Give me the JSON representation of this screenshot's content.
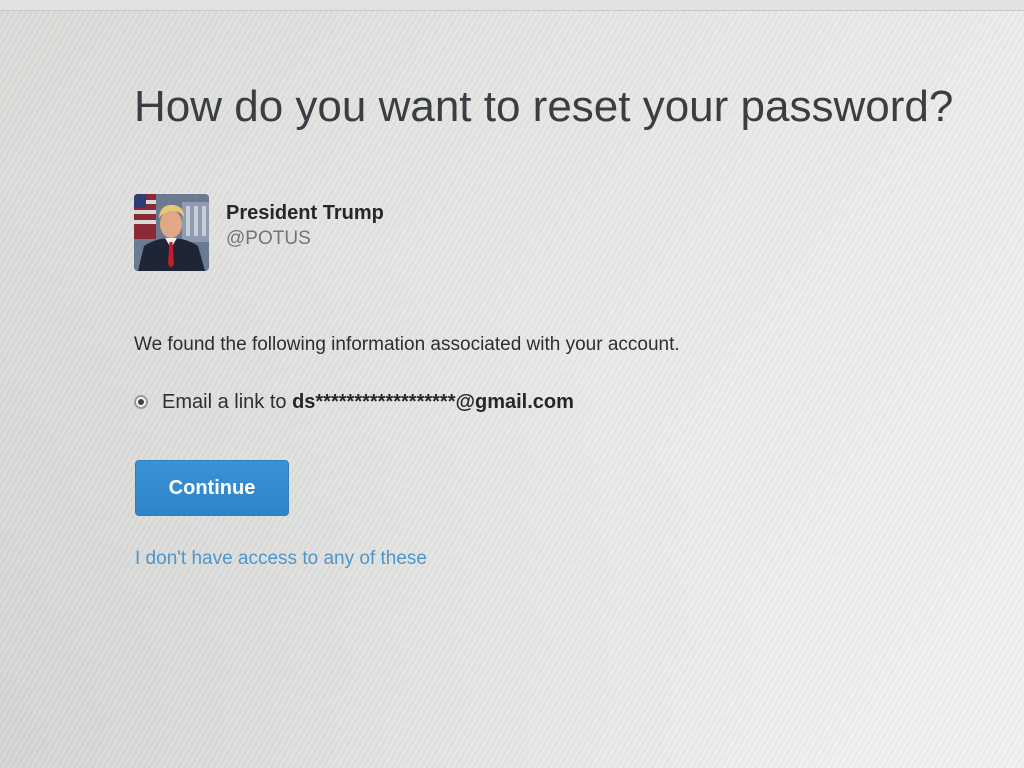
{
  "page": {
    "title": "How do you want to reset your password?"
  },
  "account": {
    "name": "President Trump",
    "handle": "@POTUS",
    "avatar_icon": "profile-photo"
  },
  "info_text": "We found the following information associated with your account.",
  "reset_option": {
    "label_prefix": "Email a link to",
    "email": "ds******************@gmail.com",
    "selected": true
  },
  "actions": {
    "continue_label": "Continue",
    "no_access_link": "I don't have access to any of these"
  },
  "colors": {
    "primary_button": "#2e83c8",
    "link": "#4d95cb",
    "text": "#2b2f33",
    "muted_text": "#6f7579"
  }
}
